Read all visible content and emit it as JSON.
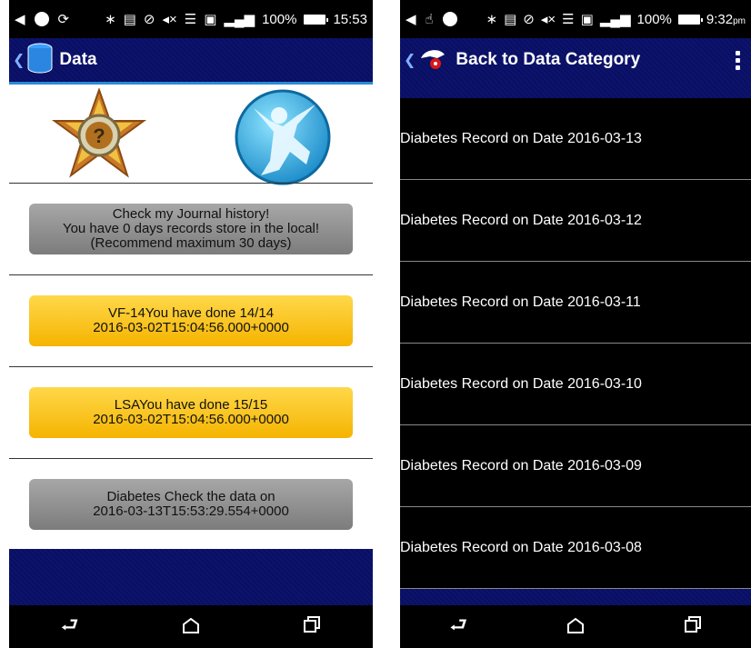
{
  "left": {
    "status": {
      "battery": "100%",
      "time": "15:53"
    },
    "action_bar": {
      "title": "Data"
    },
    "buttons": [
      {
        "lines": [
          "Check my Journal history!",
          "You have 0 days records store in the local!",
          "(Recommend maximum 30 days)"
        ]
      },
      {
        "lines": [
          "VF-14You have done 14/14",
          "2016-03-02T15:04:56.000+0000"
        ]
      },
      {
        "lines": [
          "LSAYou have done 15/15",
          "2016-03-02T15:04:56.000+0000"
        ]
      },
      {
        "lines": [
          "Diabetes Check the data on",
          "2016-03-13T15:53:29.554+0000"
        ]
      }
    ]
  },
  "right": {
    "status": {
      "battery": "100%",
      "time": "9:32",
      "ampm": "pm"
    },
    "action_bar": {
      "title": "Back to Data Category"
    },
    "records": [
      "Diabetes Record on Date 2016-03-13",
      "Diabetes Record on Date 2016-03-12",
      "Diabetes Record on Date 2016-03-11",
      "Diabetes Record on Date 2016-03-10",
      "Diabetes Record on Date 2016-03-09",
      "Diabetes Record on Date 2016-03-08"
    ]
  },
  "icons": {
    "status_left": [
      "notification-icon",
      "circle-icon",
      "sync-icon"
    ],
    "status_right": [
      "bluetooth-icon",
      "nfc-icon",
      "no-disturb-icon",
      "mute-icon",
      "wifi-icon",
      "cast-icon",
      "signal-icon",
      "battery-icon"
    ],
    "nav": [
      "back-icon",
      "home-icon",
      "recents-icon"
    ]
  }
}
